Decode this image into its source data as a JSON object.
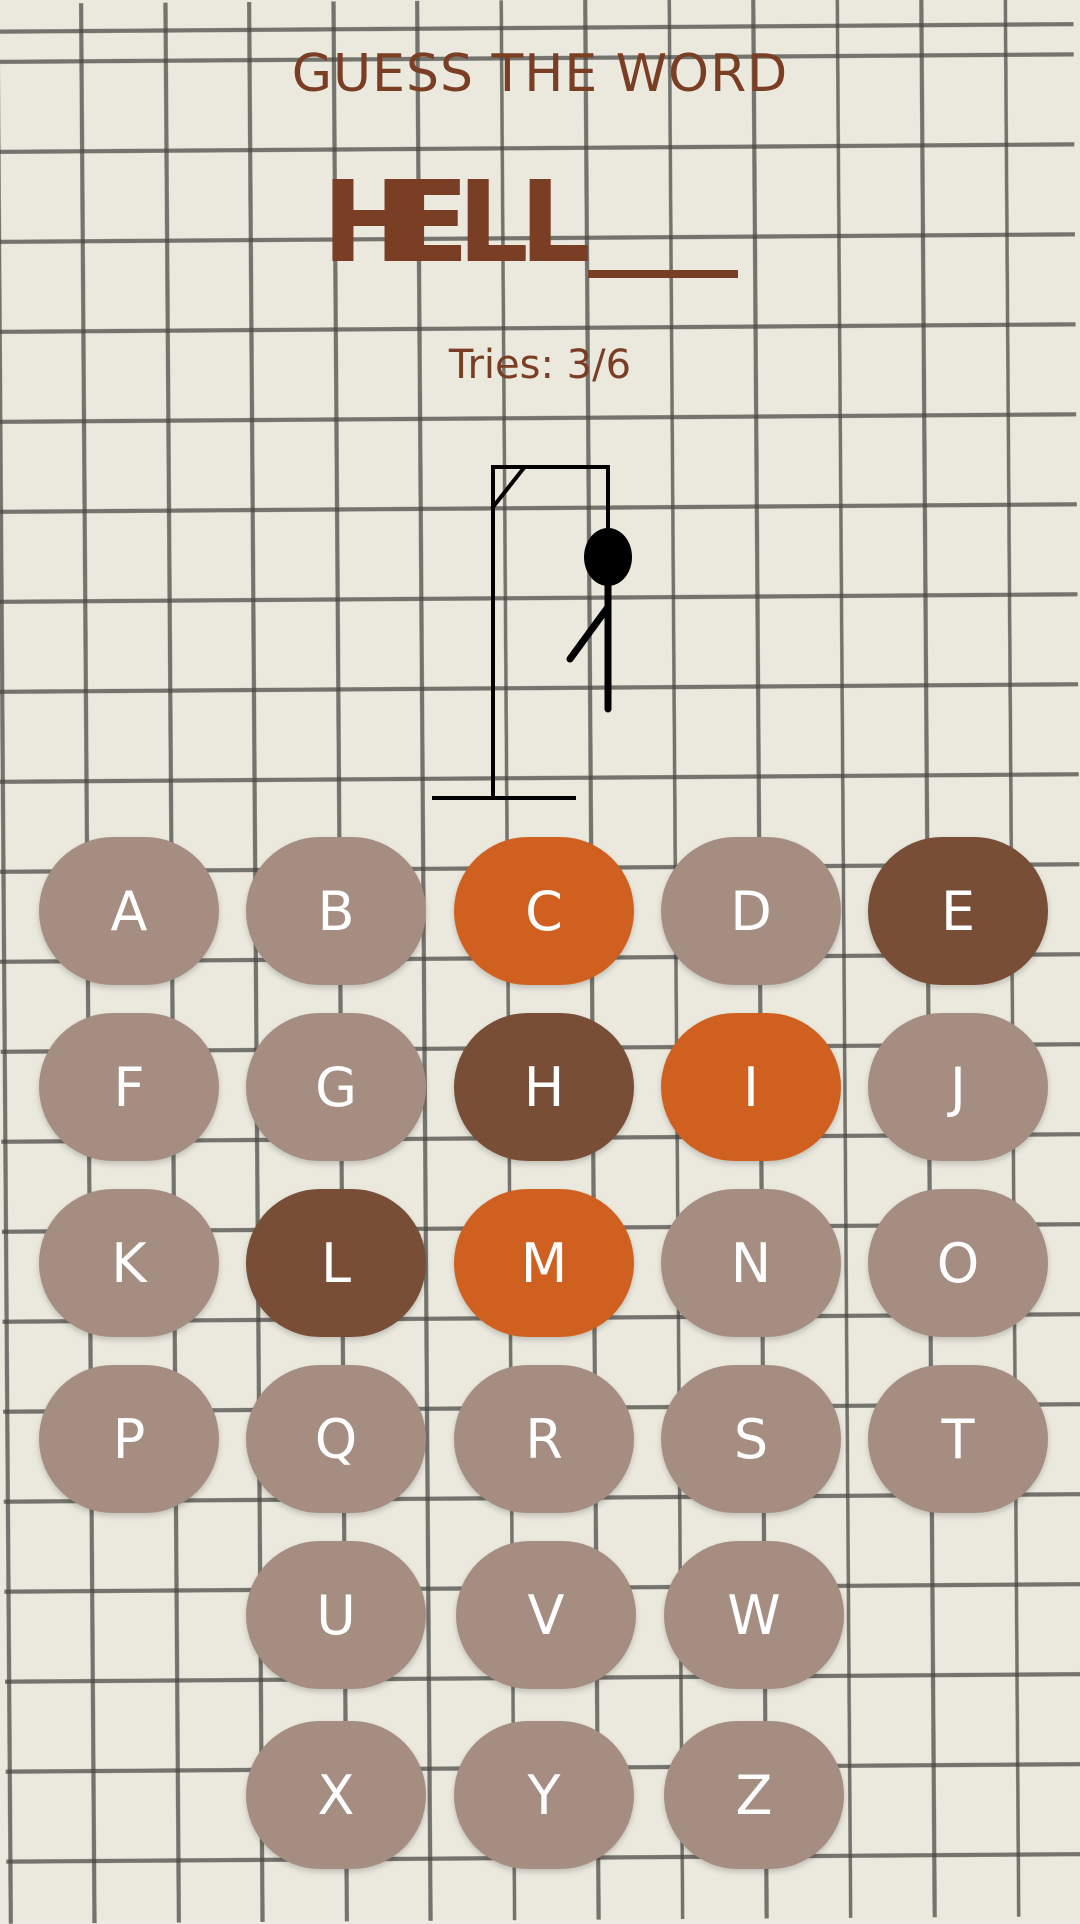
{
  "header": {
    "title": "GUESS THE WORD",
    "tries_text": "Tries: 3/6"
  },
  "word": {
    "revealed": [
      "H",
      "E",
      "L",
      "L"
    ],
    "blanks": 1
  },
  "tries": {
    "used": 3,
    "max": 6
  },
  "colors": {
    "text": "#7a3e24",
    "key_default": "#a58d81",
    "key_correct": "#784e37",
    "key_wrong": "#d06020",
    "key_label": "#ffffff"
  },
  "keyboard": {
    "keys": [
      {
        "letter": "A",
        "state": "unused"
      },
      {
        "letter": "B",
        "state": "unused"
      },
      {
        "letter": "C",
        "state": "wrong"
      },
      {
        "letter": "D",
        "state": "unused"
      },
      {
        "letter": "E",
        "state": "correct"
      },
      {
        "letter": "F",
        "state": "unused"
      },
      {
        "letter": "G",
        "state": "unused"
      },
      {
        "letter": "H",
        "state": "correct"
      },
      {
        "letter": "I",
        "state": "wrong"
      },
      {
        "letter": "J",
        "state": "unused"
      },
      {
        "letter": "K",
        "state": "unused"
      },
      {
        "letter": "L",
        "state": "correct"
      },
      {
        "letter": "M",
        "state": "wrong"
      },
      {
        "letter": "N",
        "state": "unused"
      },
      {
        "letter": "O",
        "state": "unused"
      },
      {
        "letter": "P",
        "state": "unused"
      },
      {
        "letter": "Q",
        "state": "unused"
      },
      {
        "letter": "R",
        "state": "unused"
      },
      {
        "letter": "S",
        "state": "unused"
      },
      {
        "letter": "T",
        "state": "unused"
      },
      {
        "letter": "U",
        "state": "unused"
      },
      {
        "letter": "V",
        "state": "unused"
      },
      {
        "letter": "W",
        "state": "unused"
      },
      {
        "letter": "X",
        "state": "unused"
      },
      {
        "letter": "Y",
        "state": "unused"
      },
      {
        "letter": "Z",
        "state": "unused"
      }
    ]
  }
}
